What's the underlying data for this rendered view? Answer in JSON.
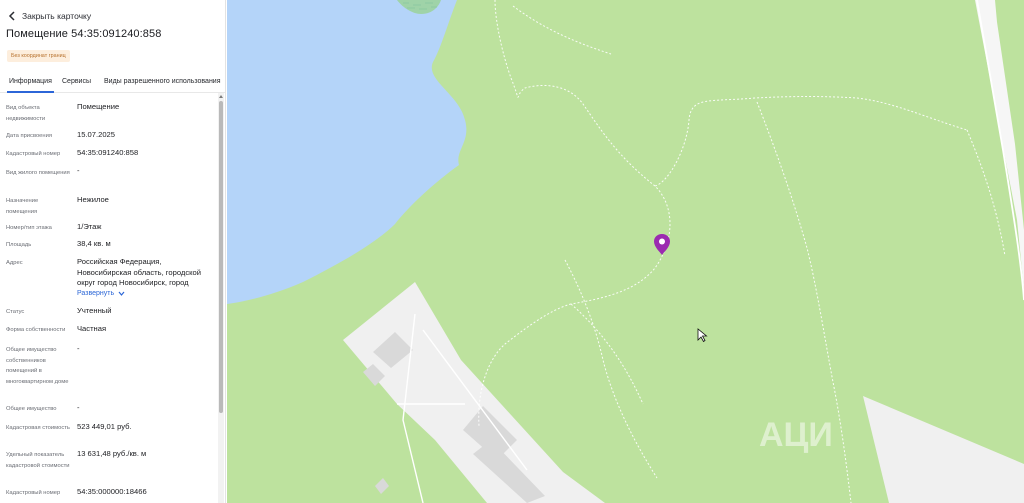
{
  "panel": {
    "back_label": "Закрыть карточку",
    "title": "Помещение 54:35:091240:858",
    "badge": "Без координат границ",
    "tabs": [
      {
        "label": "Информация",
        "active": true
      },
      {
        "label": "Сервисы",
        "active": false
      },
      {
        "label": "Виды разрешенного использования",
        "active": false
      }
    ],
    "rows": [
      {
        "label": "Вид объекта недвижимости",
        "value": "Помещение"
      },
      {
        "label": "Дата присвоения",
        "value": "15.07.2025"
      },
      {
        "label": "Кадастровый номер",
        "value": "54:35:091240:858"
      },
      {
        "label": "Вид жилого помещения",
        "value": "-"
      },
      {
        "label": "Назначение помещения",
        "value": "Нежилое"
      },
      {
        "label": "Номер/тип этажа",
        "value": "1/Этаж"
      },
      {
        "label": "Площадь",
        "value": "38,4 кв. м"
      },
      {
        "label": "Адрес",
        "value": "Российская Федерация, Новосибирская область, городской округ город Новосибирск, город"
      },
      {
        "label": "Статус",
        "value": "Учтенный"
      },
      {
        "label": "Форма собственности",
        "value": "Частная"
      },
      {
        "label": "Общее имущество собственников помещений в многоквартирном доме",
        "value": "-"
      },
      {
        "label": "Общее имущество",
        "value": "-"
      },
      {
        "label": "Кадастровая стоимость",
        "value": "523 449,01 руб."
      },
      {
        "label": "Удельный показатель кадастровой стоимости",
        "value": "13 631,48 руб./кв. м"
      },
      {
        "label": "Кадастровый номер",
        "value": "54:35:000000:18466"
      }
    ],
    "expand_label": "Развернуть"
  },
  "map": {
    "watermark": "АЦИ",
    "colors": {
      "water": "#b4d4f9",
      "forest": "#bde29e",
      "urban": "#f0f0f0",
      "building": "#d9d9d9",
      "marker": "#9b2bb0",
      "path": "#ffffff"
    }
  }
}
